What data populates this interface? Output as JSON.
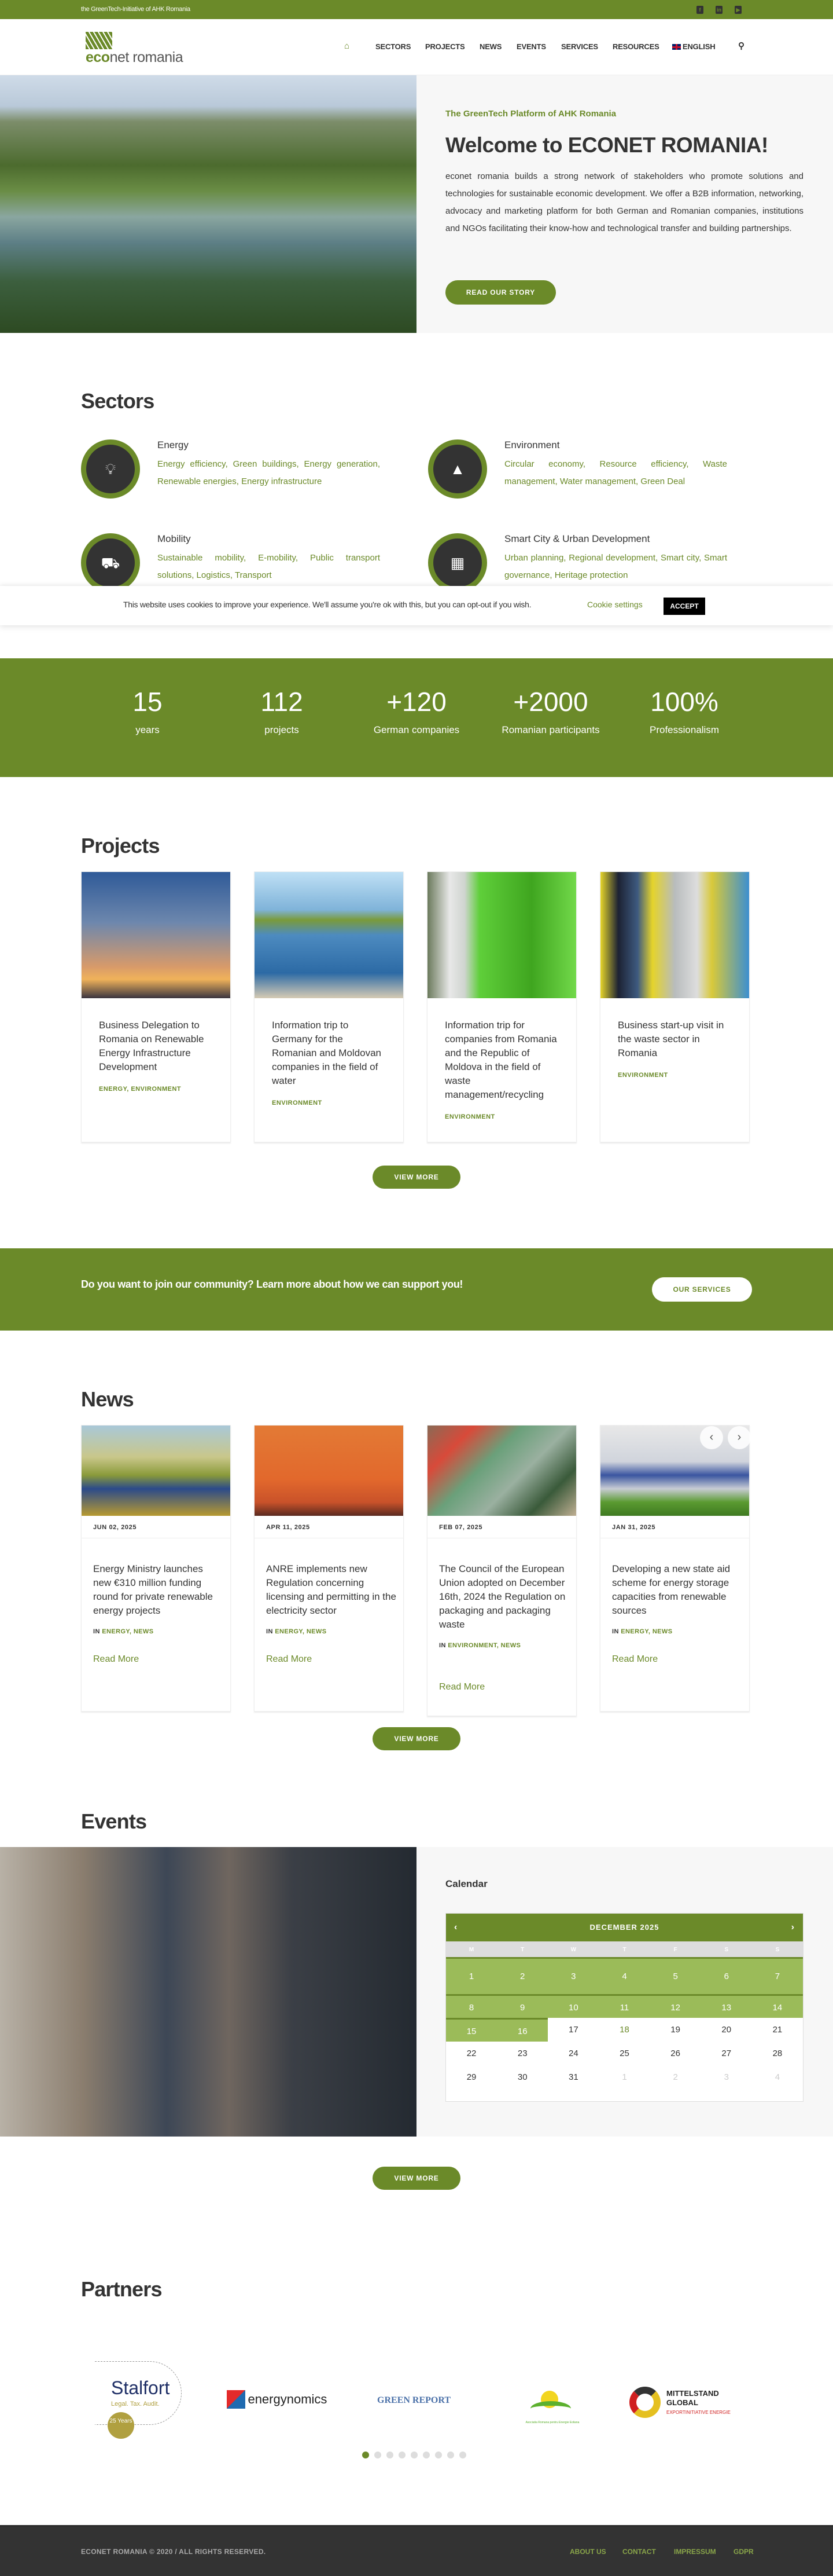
{
  "topbar": {
    "tagline": "the GreenTech-Initiative of AHK Romania",
    "social": [
      "facebook-icon",
      "linkedin-icon",
      "youtube-icon"
    ]
  },
  "logo": {
    "bold": "eco",
    "rest": "net romania"
  },
  "nav": {
    "items": [
      "SECTORS",
      "PROJECTS",
      "NEWS",
      "EVENTS",
      "SERVICES",
      "RESOURCES"
    ],
    "language": "ENGLISH"
  },
  "hero": {
    "kicker": "The GreenTech Platform of AHK Romania",
    "title": "Welcome to ECONET ROMANIA!",
    "body": "econet romania builds a strong network of stakeholders who promote solutions and technologies for sustainable economic development. We offer a B2B information, networking, advocacy and marketing platform for both German and Romanian companies, institutions and NGOs facilitating their know-how and technological transfer and building partnerships.",
    "button": "READ OUR STORY"
  },
  "sectors": {
    "title": "Sectors",
    "items": [
      {
        "name": "Energy",
        "tags": "Energy efficiency, Green buildings, Energy generation, Renewable energies, Energy infrastructure",
        "icon": "lightbulb-icon"
      },
      {
        "name": "Environment",
        "tags": "Circular economy, Resource efficiency, Waste management, Water management, Green Deal",
        "icon": "tree-icon"
      },
      {
        "name": "Mobility",
        "tags": "Sustainable mobility, E-mobility, Public transport solutions, Logistics, Transport",
        "icon": "truck-icon"
      },
      {
        "name": "Smart City & Urban Development",
        "tags": "Urban planning, Regional development, Smart city, Smart governance, Heritage protection",
        "icon": "building-icon"
      }
    ]
  },
  "cookie": {
    "text": "This website uses cookies to improve your experience. We'll assume you're ok with this, but you can opt-out if you wish.",
    "settings": "Cookie settings",
    "accept": "ACCEPT"
  },
  "stats": [
    {
      "value": "15",
      "label": "years"
    },
    {
      "value": "112",
      "label": "projects"
    },
    {
      "value": "+120",
      "label": "German companies"
    },
    {
      "value": "+2000",
      "label": "Romanian participants"
    },
    {
      "value": "100%",
      "label": "Professionalism"
    }
  ],
  "projects": {
    "title": "Projects",
    "view_more": "VIEW MORE",
    "items": [
      {
        "title": "Business Delegation to Romania on Renewable Energy Infrastructure Development",
        "tags": "ENERGY, ENVIRONMENT"
      },
      {
        "title": "Information trip to Germany for the Romanian and Moldovan companies in the field of water",
        "tags": "ENVIRONMENT"
      },
      {
        "title": "Information trip for companies from Romania and the Republic of Moldova in the field of waste management/recycling",
        "tags": "ENVIRONMENT"
      },
      {
        "title": "Business start-up visit in the waste sector in Romania",
        "tags": "ENVIRONMENT"
      }
    ]
  },
  "cta": {
    "text": "Do you want to join our community? Learn more about how we can support you!",
    "button": "OUR SERVICES"
  },
  "news": {
    "title": "News",
    "in_label": "IN",
    "read_more": "Read More",
    "view_more": "VIEW MORE",
    "items": [
      {
        "date": "JUN 02, 2025",
        "title": "Energy Ministry launches new €310 million funding round for private renewable energy projects",
        "categories": "ENERGY, NEWS"
      },
      {
        "date": "APR 11, 2025",
        "title": "ANRE implements new Regulation concerning licensing and permitting in the electricity sector",
        "categories": "ENERGY, NEWS"
      },
      {
        "date": "FEB 07, 2025",
        "title": "The Council of the European Union adopted on December 16th, 2024 the Regulation on packaging and packaging waste",
        "categories": "ENVIRONMENT, NEWS"
      },
      {
        "date": "JAN 31, 2025",
        "title": "Developing a new state aid scheme for energy storage capacities from renewable sources",
        "categories": "ENERGY, NEWS"
      }
    ]
  },
  "events": {
    "title": "Events",
    "view_more": "VIEW MORE",
    "calendar": {
      "title": "Calendar",
      "month": "DECEMBER 2025",
      "weekdays": [
        "M",
        "T",
        "W",
        "T",
        "F",
        "S",
        "S"
      ],
      "weeks": [
        [
          "1",
          "2",
          "3",
          "4",
          "5",
          "6",
          "7"
        ],
        [
          "8",
          "9",
          "10",
          "11",
          "12",
          "13",
          "14"
        ],
        [
          "15",
          "16",
          "17",
          "18",
          "19",
          "20",
          "21"
        ],
        [
          "22",
          "23",
          "24",
          "25",
          "26",
          "27",
          "28"
        ],
        [
          "29",
          "30",
          "31",
          "1",
          "2",
          "3",
          "4"
        ]
      ],
      "highlighted_through_day": 16,
      "today": 18
    }
  },
  "partners": {
    "title": "Partners",
    "logos": [
      {
        "name": "Stalfort",
        "sub": "Legal. Tax. Audit.",
        "badge": "25 Years"
      },
      {
        "name": "energynomics"
      },
      {
        "name": "GREEN REPORT"
      },
      {
        "name": "Asociatia Romana pentru Energie Eoliana"
      },
      {
        "name": "MITTELSTAND GLOBAL",
        "sub": "EXPORTINITIATIVE ENERGIE"
      }
    ],
    "slides": 9,
    "active_slide": 1
  },
  "footer": {
    "copyright": "ECONET ROMANIA © 2020 / ALL RIGHTS RESERVED.",
    "links": [
      "ABOUT US",
      "CONTACT",
      "IMPRESSUM",
      "GDPR"
    ]
  },
  "colors": {
    "brand": "#6b8a29",
    "highlight": "#9bbb59",
    "dark": "#333333"
  }
}
